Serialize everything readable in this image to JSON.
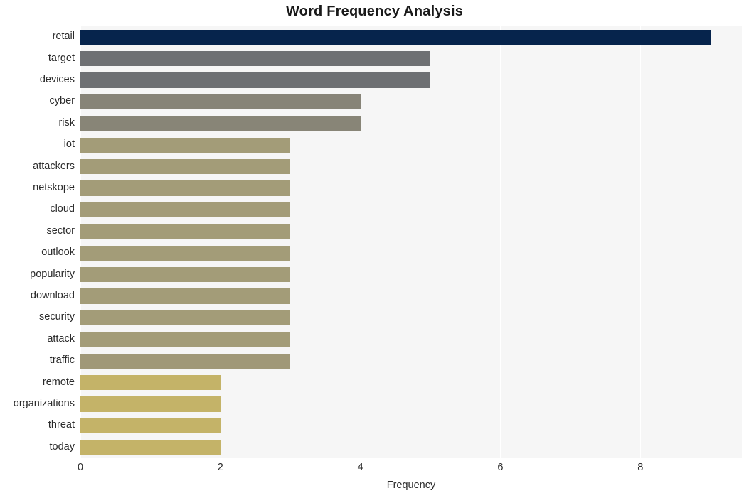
{
  "chart_data": {
    "type": "bar",
    "orientation": "horizontal",
    "title": "Word Frequency Analysis",
    "xlabel": "Frequency",
    "ylabel": "",
    "categories": [
      "retail",
      "target",
      "devices",
      "cyber",
      "risk",
      "iot",
      "attackers",
      "netskope",
      "cloud",
      "sector",
      "outlook",
      "popularity",
      "download",
      "security",
      "attack",
      "traffic",
      "remote",
      "organizations",
      "threat",
      "today"
    ],
    "values": [
      9,
      5,
      5,
      4,
      4,
      3,
      3,
      3,
      3,
      3,
      3,
      3,
      3,
      3,
      3,
      3,
      2,
      2,
      2,
      2
    ],
    "bar_colors": [
      "#06244c",
      "#6e7073",
      "#6e7073",
      "#878478",
      "#888577",
      "#a39c78",
      "#a39c78",
      "#a39c78",
      "#a39c78",
      "#a39c78",
      "#a39c78",
      "#a39c78",
      "#a39c78",
      "#a39c78",
      "#a39c78",
      "#a09878",
      "#c4b368",
      "#c4b368",
      "#c4b368",
      "#c4b368"
    ],
    "xticks": [
      0,
      2,
      4,
      6,
      8
    ],
    "xlim": [
      0,
      9.45
    ],
    "grid": "vertical",
    "legend": "none",
    "plot_background": "#f6f6f6",
    "gridline_color": "#ffffff",
    "figure_background": "#ffffff",
    "title_color": "#1a1a1a",
    "tick_label_color": "#2b2b2b"
  }
}
